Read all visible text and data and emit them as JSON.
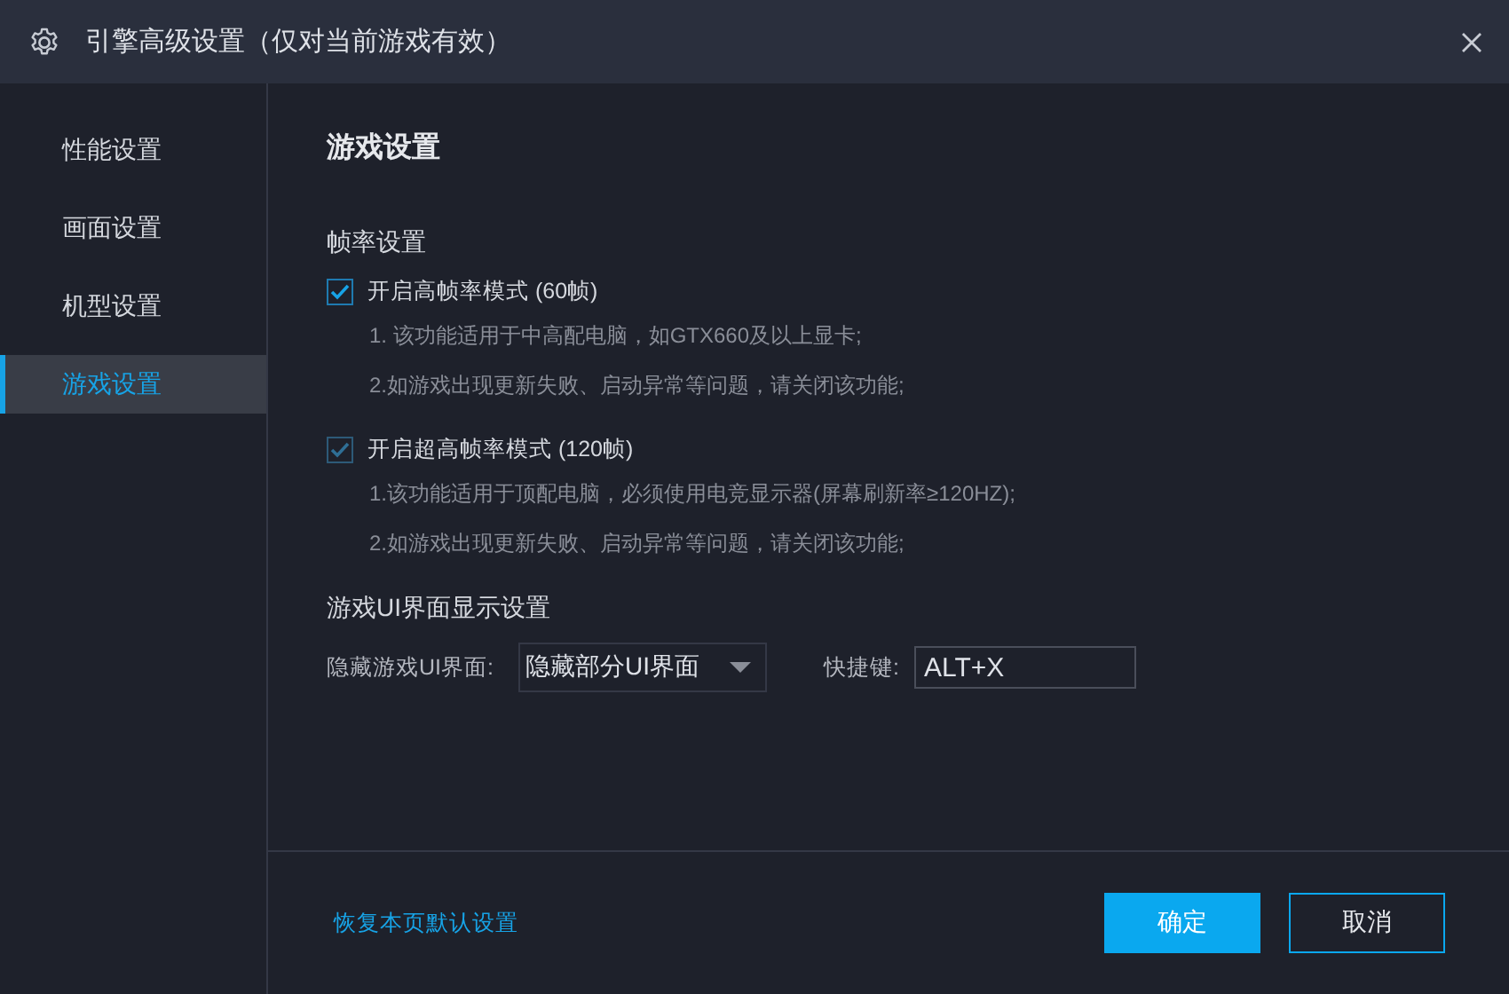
{
  "window": {
    "title": "引擎高级设置（仅对当前游戏有效）"
  },
  "sidebar": {
    "items": [
      {
        "label": "性能设置",
        "selected": false
      },
      {
        "label": "画面设置",
        "selected": false
      },
      {
        "label": "机型设置",
        "selected": false
      },
      {
        "label": "游戏设置",
        "selected": true
      }
    ]
  },
  "content": {
    "heading": "游戏设置",
    "frame_rate": {
      "title": "帧率设置",
      "options": [
        {
          "label": "开启高帧率模式 (60帧)",
          "checked": true,
          "disabled": false,
          "notes": [
            "1. 该功能适用于中高配电脑，如GTX660及以上显卡;",
            "2.如游戏出现更新失败、启动异常等问题，请关闭该功能;"
          ]
        },
        {
          "label": "开启超高帧率模式 (120帧)",
          "checked": true,
          "disabled": true,
          "notes": [
            "1.该功能适用于顶配电脑，必须使用电竞显示器(屏幕刷新率≥120HZ);",
            "2.如游戏出现更新失败、启动异常等问题，请关闭该功能;"
          ]
        }
      ]
    },
    "ui_display": {
      "title": "游戏UI界面显示设置",
      "hide_label": "隐藏游戏UI界面:",
      "hide_value": "隐藏部分UI界面",
      "hotkey_label": "快捷键:",
      "hotkey_value": "ALT+X"
    }
  },
  "footer": {
    "reset_link": "恢复本页默认设置",
    "buttons": [
      {
        "label": "确定",
        "kind": "primary"
      },
      {
        "label": "取消",
        "kind": "secondary"
      }
    ]
  }
}
